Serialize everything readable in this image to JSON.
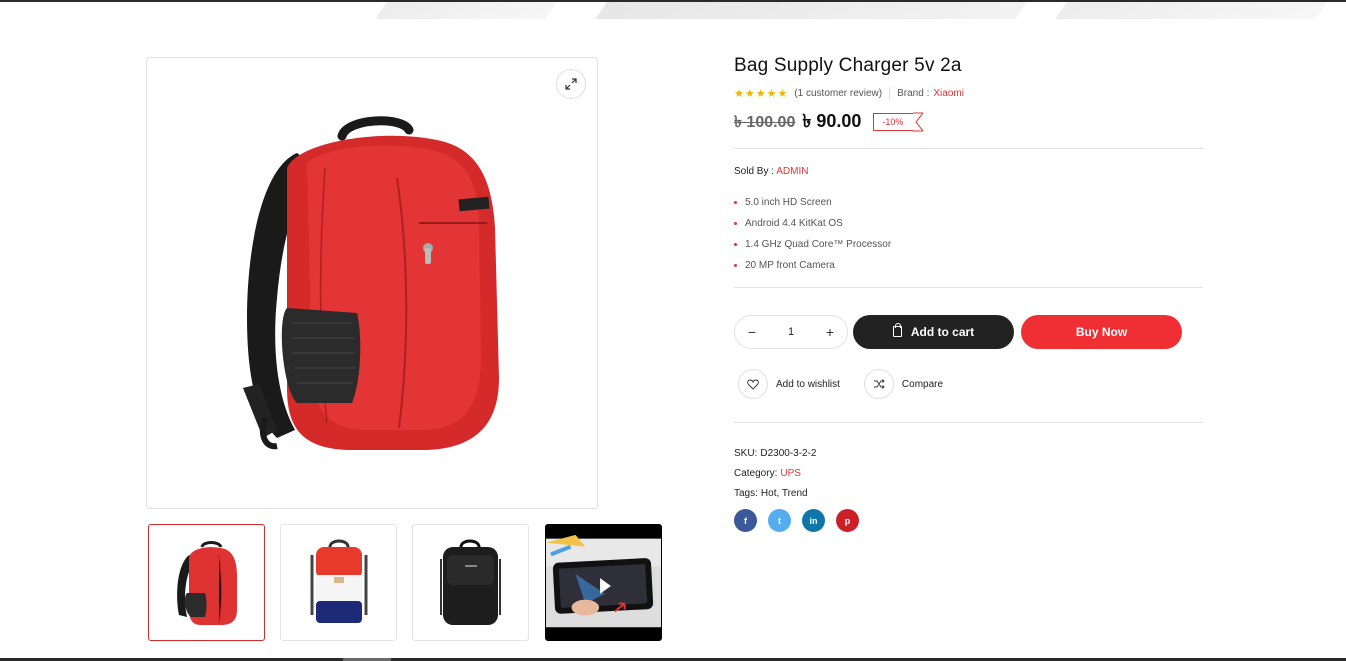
{
  "product": {
    "title": "Bag Supply Charger 5v 2a",
    "rating_stars": "★★★★★",
    "review_text": "(1 customer review)",
    "brand_label": "Brand :",
    "brand_value": "Xiaomi",
    "old_price": "৳ 100.00",
    "new_price": "৳ 90.00",
    "discount": "-10%",
    "sold_by_label": "Sold By :",
    "sold_by_value": "ADMIN",
    "features": [
      "5.0 inch HD Screen",
      "Android 4.4 KitKat OS",
      "1.4 GHz Quad Core™ Processor",
      "20 MP front Camera"
    ],
    "quantity": "1",
    "add_to_cart": "Add to cart",
    "buy_now": "Buy Now",
    "wishlist": "Add to wishlist",
    "compare": "Compare",
    "sku_label": "SKU:",
    "sku_value": "D2300-3-2-2",
    "category_label": "Category:",
    "category_value": "UPS",
    "tags_label": "Tags:",
    "tags_value": "Hot, Trend"
  },
  "icons": {
    "zoom": "expand-icon",
    "qty_minus": "−",
    "qty_plus": "+",
    "cart": "shopping-bag-icon",
    "wishlist": "heart-icon",
    "compare": "shuffle-icon",
    "social": [
      "facebook-icon",
      "twitter-icon",
      "linkedin-icon",
      "pinterest-icon"
    ]
  },
  "social_glyphs": [
    "f",
    "t",
    "in",
    "p"
  ],
  "colors": {
    "accent": "#ef2f33",
    "dark": "#222222",
    "stars": "#f0b400",
    "facebook": "#3b5998",
    "twitter": "#55acee",
    "linkedin": "#0e76a8",
    "pinterest": "#cb2027"
  },
  "gallery": {
    "thumbnails": [
      "red-backpack",
      "red-white-blue-backpack",
      "black-backpack",
      "video-thumbnail"
    ]
  }
}
